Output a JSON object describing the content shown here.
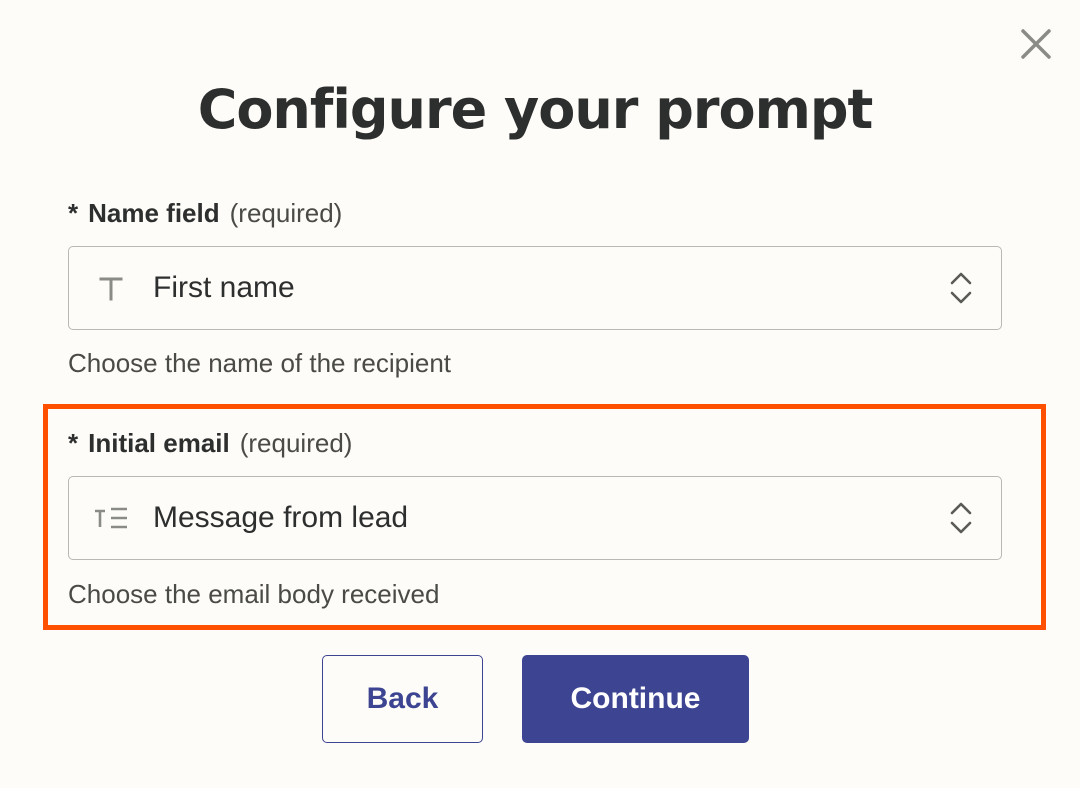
{
  "dialog": {
    "title": "Configure your prompt",
    "close_icon": "close-icon"
  },
  "fields": [
    {
      "required_marker": "*",
      "label": "Name field",
      "required_text": "(required)",
      "value": "First name",
      "type_icon": "text-type-icon",
      "help": "Choose the name of the recipient"
    },
    {
      "required_marker": "*",
      "label": "Initial email",
      "required_text": "(required)",
      "value": "Message from lead",
      "type_icon": "long-text-type-icon",
      "help": "Choose the email body received",
      "highlighted": true
    }
  ],
  "actions": {
    "back_label": "Back",
    "continue_label": "Continue"
  },
  "colors": {
    "accent": "#3d4592",
    "highlight": "#ff4f00",
    "background": "#fdfcf8"
  }
}
